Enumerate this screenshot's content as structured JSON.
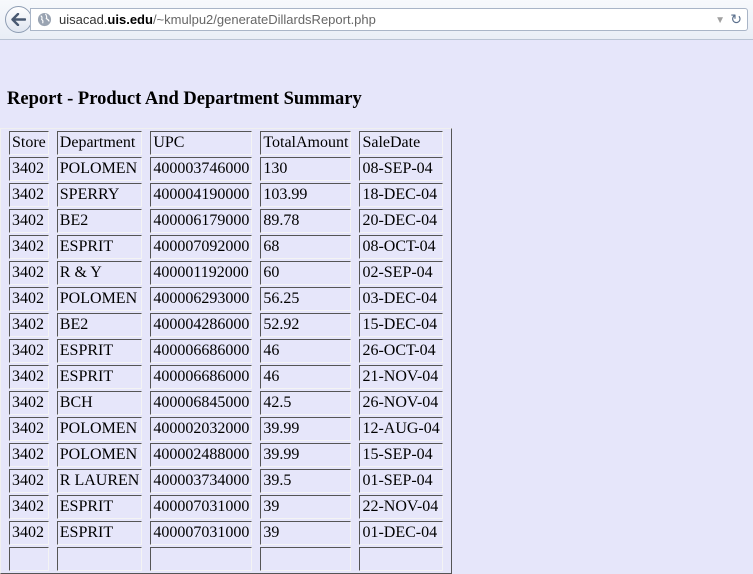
{
  "browser": {
    "url_host_prefix": "uisacad.",
    "url_domain": "uis.edu",
    "url_path": "/~kmulpu2/generateDillardsReport.php"
  },
  "page": {
    "title": "Report - Product And Department Summary"
  },
  "table": {
    "headers": {
      "store": "Store",
      "department": "Department",
      "upc": "UPC",
      "total_amount": "TotalAmount",
      "sale_date": "SaleDate"
    },
    "rows": [
      {
        "store": "3402",
        "department": "POLOMEN",
        "upc": "400003746000",
        "total_amount": "130",
        "sale_date": "08-SEP-04"
      },
      {
        "store": "3402",
        "department": "SPERRY",
        "upc": "400004190000",
        "total_amount": "103.99",
        "sale_date": "18-DEC-04"
      },
      {
        "store": "3402",
        "department": "BE2",
        "upc": "400006179000",
        "total_amount": "89.78",
        "sale_date": "20-DEC-04"
      },
      {
        "store": "3402",
        "department": "ESPRIT",
        "upc": "400007092000",
        "total_amount": "68",
        "sale_date": "08-OCT-04"
      },
      {
        "store": "3402",
        "department": "R & Y",
        "upc": "400001192000",
        "total_amount": "60",
        "sale_date": "02-SEP-04"
      },
      {
        "store": "3402",
        "department": "POLOMEN",
        "upc": "400006293000",
        "total_amount": "56.25",
        "sale_date": "03-DEC-04"
      },
      {
        "store": "3402",
        "department": "BE2",
        "upc": "400004286000",
        "total_amount": "52.92",
        "sale_date": "15-DEC-04"
      },
      {
        "store": "3402",
        "department": "ESPRIT",
        "upc": "400006686000",
        "total_amount": "46",
        "sale_date": "26-OCT-04"
      },
      {
        "store": "3402",
        "department": "ESPRIT",
        "upc": "400006686000",
        "total_amount": "46",
        "sale_date": "21-NOV-04"
      },
      {
        "store": "3402",
        "department": "BCH",
        "upc": "400006845000",
        "total_amount": "42.5",
        "sale_date": "26-NOV-04"
      },
      {
        "store": "3402",
        "department": "POLOMEN",
        "upc": "400002032000",
        "total_amount": "39.99",
        "sale_date": "12-AUG-04"
      },
      {
        "store": "3402",
        "department": "POLOMEN",
        "upc": "400002488000",
        "total_amount": "39.99",
        "sale_date": "15-SEP-04"
      },
      {
        "store": "3402",
        "department": "R LAUREN",
        "upc": "400003734000",
        "total_amount": "39.5",
        "sale_date": "01-SEP-04"
      },
      {
        "store": "3402",
        "department": "ESPRIT",
        "upc": "400007031000",
        "total_amount": "39",
        "sale_date": "22-NOV-04"
      },
      {
        "store": "3402",
        "department": "ESPRIT",
        "upc": "400007031000",
        "total_amount": "39",
        "sale_date": "01-DEC-04"
      },
      {
        "store": "",
        "department": "",
        "upc": "",
        "total_amount": "",
        "sale_date": ""
      }
    ]
  }
}
